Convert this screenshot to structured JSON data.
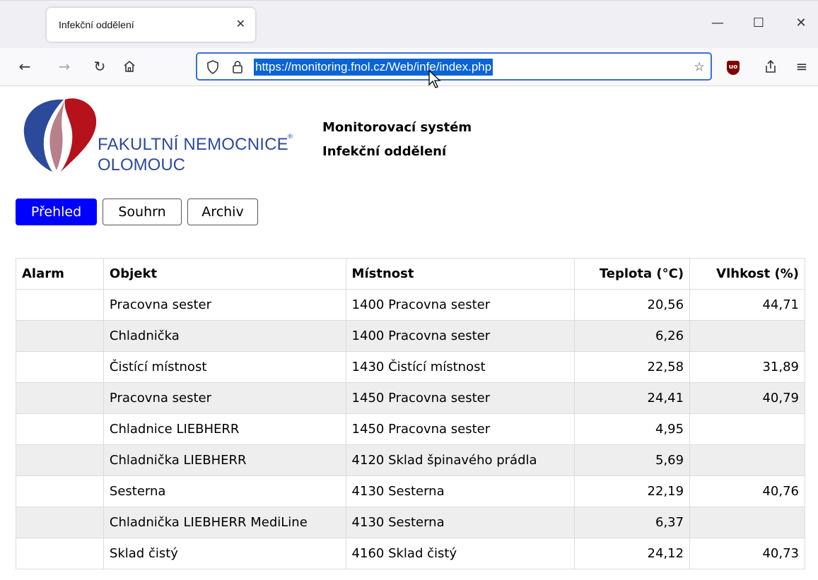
{
  "browser": {
    "tab_title": "Infekční oddělení",
    "tab_close": "✕",
    "url": "https://monitoring.fnol.cz/Web/infe/index.php",
    "window_minimize": "—",
    "window_maximize": "☐",
    "window_close": "✕"
  },
  "logo": {
    "line1": "FAKULTNÍ NEMOCNICE",
    "line2": "OLOMOUC",
    "registered": "®",
    "colors": {
      "red": "#b5121b",
      "blue": "#2c4a9a"
    }
  },
  "header": {
    "title": "Monitorovací systém",
    "subtitle": "Infekční oddělení"
  },
  "nav": {
    "overview": "Přehled",
    "summary": "Souhrn",
    "archive": "Archiv",
    "active": "overview"
  },
  "table": {
    "columns": [
      "Alarm",
      "Objekt",
      "Místnost",
      "Teplota (°C)",
      "Vlhkost (%)"
    ],
    "rows": [
      {
        "alarm": "",
        "object": "Pracovna sester",
        "room": "1400 Pracovna sester",
        "temp": "20,56",
        "humidity": "44,71"
      },
      {
        "alarm": "",
        "object": "Chladnička",
        "room": "1400 Pracovna sester",
        "temp": "6,26",
        "humidity": ""
      },
      {
        "alarm": "",
        "object": "Čistící místnost",
        "room": "1430 Čistící místnost",
        "temp": "22,58",
        "humidity": "31,89"
      },
      {
        "alarm": "",
        "object": "Pracovna sester",
        "room": "1450 Pracovna sester",
        "temp": "24,41",
        "humidity": "40,79"
      },
      {
        "alarm": "",
        "object": "Chladnice LIEBHERR",
        "room": "1450 Pracovna sester",
        "temp": "4,95",
        "humidity": ""
      },
      {
        "alarm": "",
        "object": "Chladnička LIEBHERR",
        "room": "4120 Sklad špinavého prádla",
        "temp": "5,69",
        "humidity": ""
      },
      {
        "alarm": "",
        "object": "Sesterna",
        "room": "4130 Sesterna",
        "temp": "22,19",
        "humidity": "40,76"
      },
      {
        "alarm": "",
        "object": "Chladnička LIEBHERR MediLine",
        "room": "4130 Sesterna",
        "temp": "6,37",
        "humidity": ""
      },
      {
        "alarm": "",
        "object": "Sklad čistý",
        "room": "4160 Sklad čistý",
        "temp": "24,12",
        "humidity": "40,73"
      }
    ]
  }
}
